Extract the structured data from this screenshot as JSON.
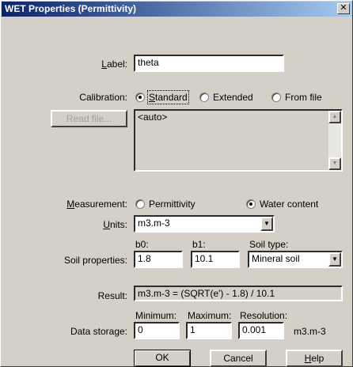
{
  "window": {
    "title": "WET Properties (Permittivity)",
    "close_glyph": "✕"
  },
  "label_field": {
    "label_pre": "",
    "label_u": "L",
    "label_post": "abel:",
    "value": "theta"
  },
  "calibration": {
    "label": "Calibration:",
    "options": [
      {
        "label_u": "S",
        "label_post": "tandard",
        "selected": true
      },
      {
        "label_u": "",
        "label_post": "Extended",
        "selected": false
      },
      {
        "label_u": "",
        "label_post": "From file",
        "selected": false
      }
    ],
    "read_file_button": "Read file...",
    "text": "<auto>"
  },
  "measurement": {
    "label_u": "M",
    "label_post": "easurement:",
    "options": [
      {
        "label": "Permittivity",
        "selected": false
      },
      {
        "label": "Water content",
        "selected": true
      }
    ]
  },
  "units": {
    "label_u": "U",
    "label_post": "nits:",
    "value": "m3.m-3"
  },
  "soil": {
    "row_label": "Soil properties:",
    "b0_label": "b0:",
    "b0_value": "1.8",
    "b1_label": "b1:",
    "b1_value": "10.1",
    "type_label": "Soil type:",
    "type_value": "Mineral soil"
  },
  "result": {
    "label": "Result:",
    "value": "m3.m-3 = (SQRT(e') - 1.8) / 10.1"
  },
  "storage": {
    "row_label": "Data storage:",
    "min_label": "Minimum:",
    "min_value": "0",
    "max_label": "Maximum:",
    "max_value": "1",
    "res_label": "Resolution:",
    "res_value": "0.001",
    "unit": "m3.m-3"
  },
  "buttons": {
    "ok": "OK",
    "cancel": "Cancel",
    "help_u": "H",
    "help_post": "elp"
  }
}
